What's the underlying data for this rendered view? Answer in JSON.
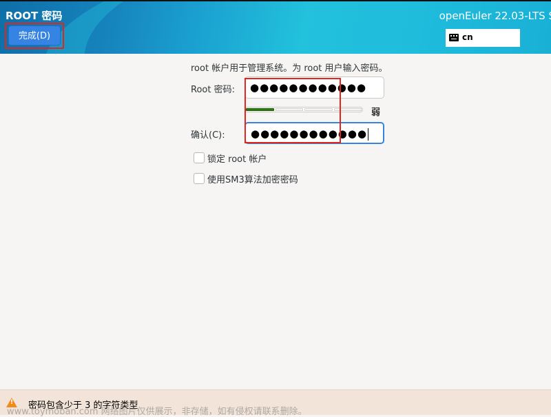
{
  "header": {
    "title": "ROOT 密码",
    "done_button": "完成(D)",
    "product": "openEuler 22.03-LTS S",
    "keyboard_layout": "cn"
  },
  "form": {
    "intro": "root 帐户用于管理系统。为 root 用户输入密码。",
    "root_password_label": "Root 密码:",
    "root_password_value": "●●●●●●●●●●●●",
    "strength": {
      "segments_total": 4,
      "segments_filled": 1,
      "label": "弱",
      "color": "#2e7d0f"
    },
    "confirm_label": "确认(C):",
    "confirm_value": "●●●●●●●●●●●●",
    "lock_root_label": "锁定 root 帐户",
    "lock_root_checked": false,
    "sm3_label": "使用SM3算法加密密码",
    "sm3_checked": false
  },
  "footer": {
    "warning": "密码包含少于 3 的字符类型",
    "watermark": "www.toymoban.com 网络图片仅供展示，非存储，如有侵权请联系删除。"
  },
  "colors": {
    "accent": "#3584e4",
    "highlight_box": "#e3261d",
    "warning": "#f08c1a"
  }
}
